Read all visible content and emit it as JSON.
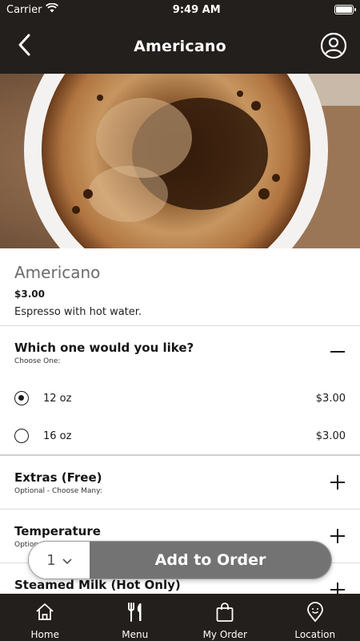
{
  "status_bar": {
    "carrier": "Carrier",
    "time": "9:49 AM"
  },
  "header": {
    "title": "Americano",
    "back_icon": "chevron-left-icon",
    "profile_icon": "user-circle-icon"
  },
  "product": {
    "name": "Americano",
    "price": "$3.00",
    "description": "Espresso with hot water."
  },
  "sections": {
    "size": {
      "title": "Which one would you like?",
      "subtitle": "Choose One:",
      "expanded": true,
      "options": [
        {
          "label": "12 oz",
          "price": "$3.00",
          "selected": true
        },
        {
          "label": "16 oz",
          "price": "$3.00",
          "selected": false
        }
      ]
    },
    "extras": {
      "title": "Extras (Free)",
      "subtitle": "Optional - Choose Many:"
    },
    "temperature": {
      "title": "Temperature",
      "subtitle": "Optional"
    },
    "steamed_milk": {
      "title": "Steamed Milk (Hot Only)"
    }
  },
  "order_bar": {
    "quantity": "1",
    "add_label": "Add to Order"
  },
  "tabs": [
    {
      "label": "Home",
      "icon": "home-icon"
    },
    {
      "label": "Menu",
      "icon": "fork-knife-icon"
    },
    {
      "label": "My Order",
      "icon": "shopping-bag-icon"
    },
    {
      "label": "Location",
      "icon": "location-pin-icon"
    }
  ],
  "colors": {
    "bar_bg": "#231f1c",
    "button_gray": "#737373"
  }
}
